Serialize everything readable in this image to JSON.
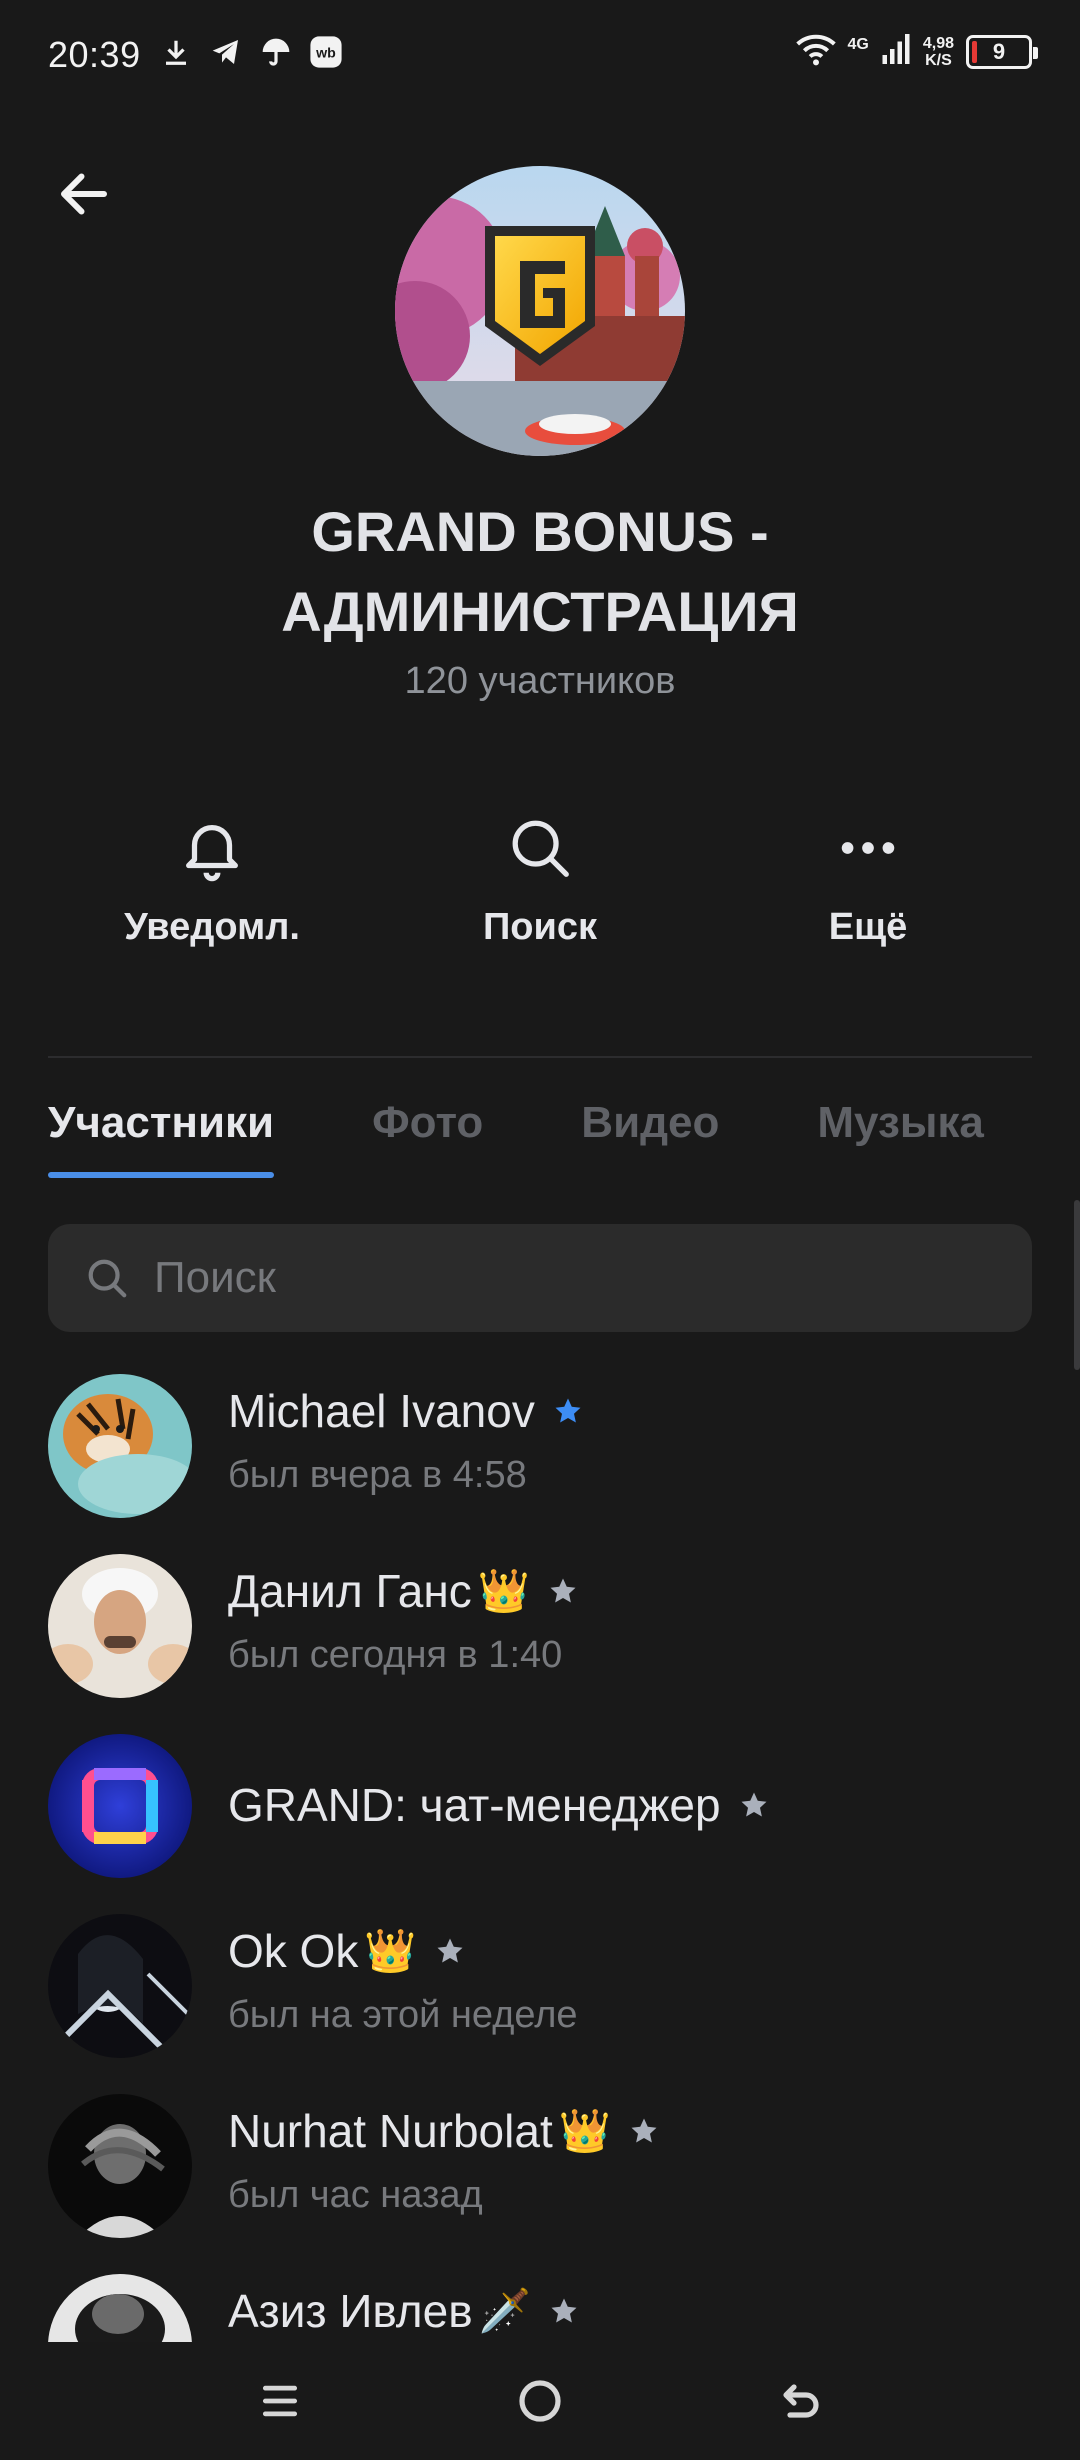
{
  "status_bar": {
    "time": "20:39",
    "network": "4G",
    "speed_value": "4,98",
    "speed_unit": "K/S",
    "battery_level": "9",
    "battery_fraction": 0.09,
    "icons": [
      "download-icon",
      "telegram-icon",
      "umbrella-icon",
      "wb-icon",
      "wifi-icon",
      "signal-icon",
      "battery-icon"
    ]
  },
  "header": {
    "back_icon": "arrow-left-icon",
    "title": "GRAND BONUS - АДМИНИСТРАЦИЯ",
    "members_count": "120 участников"
  },
  "actions": [
    {
      "label": "Уведомл.",
      "icon": "bell-icon"
    },
    {
      "label": "Поиск",
      "icon": "search-icon"
    },
    {
      "label": "Ещё",
      "icon": "more-icon"
    }
  ],
  "tabs": [
    {
      "label": "Участники",
      "active": true
    },
    {
      "label": "Фото",
      "active": false
    },
    {
      "label": "Видео",
      "active": false
    },
    {
      "label": "Музыка",
      "active": false
    }
  ],
  "search": {
    "placeholder": "Поиск"
  },
  "members": [
    {
      "name": "Michael Ivanov",
      "emoji": "",
      "status": "был вчера в 4:58",
      "star_color": "#3d8df5"
    },
    {
      "name": "Данил Ганс",
      "emoji": "👑",
      "status": "был сегодня в 1:40",
      "star_color": "#aab0bb"
    },
    {
      "name": "GRAND: чат-менеджер",
      "emoji": "",
      "status": "",
      "star_color": "#aab0bb"
    },
    {
      "name": "Ok Ok",
      "emoji": "👑",
      "status": "был на этой неделе",
      "star_color": "#aab0bb"
    },
    {
      "name": "Nurhat Nurbolat",
      "emoji": "👑",
      "status": "был час назад",
      "star_color": "#aab0bb"
    },
    {
      "name": "Азиз Ивлев",
      "emoji": "🗡️",
      "status": "",
      "star_color": "#aab0bb"
    }
  ],
  "colors": {
    "background": "#191919",
    "accent": "#4a8ee8",
    "verified_star": "#3d8df5"
  }
}
